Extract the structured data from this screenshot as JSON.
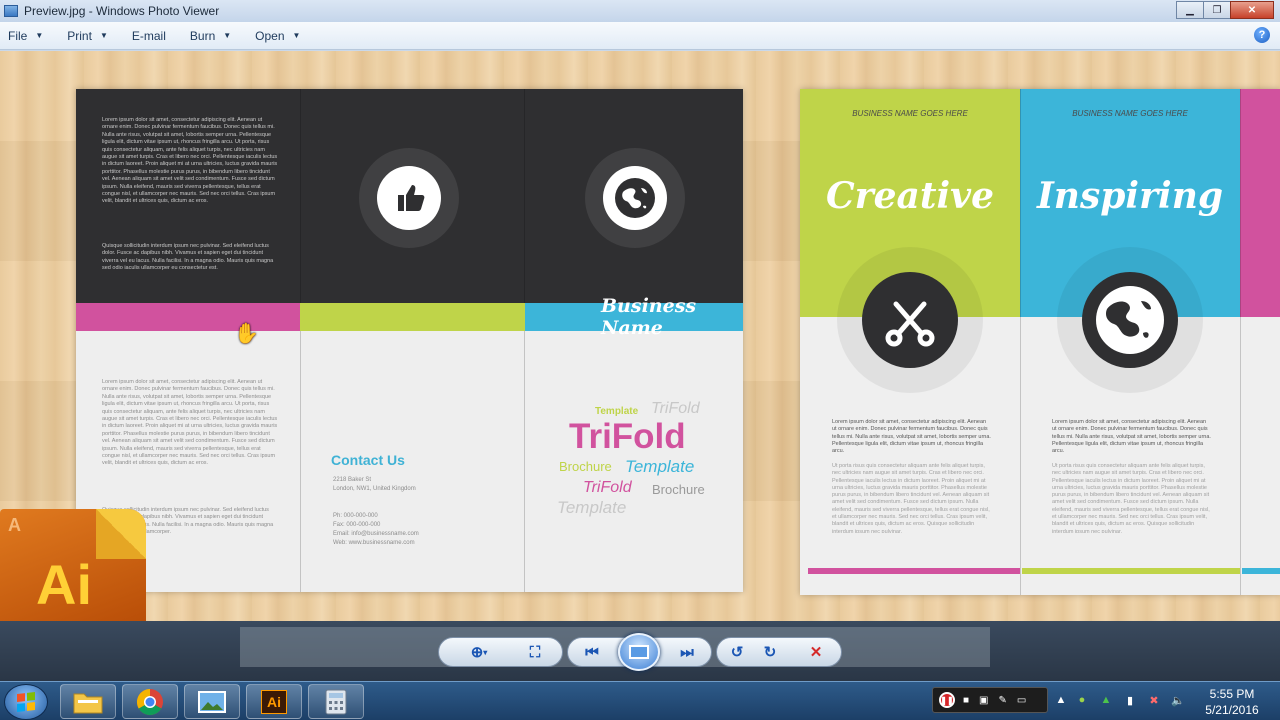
{
  "window": {
    "title": "Preview.jpg - Windows Photo Viewer"
  },
  "menu": {
    "file": "File",
    "print": "Print",
    "email": "E-mail",
    "burn": "Burn",
    "open": "Open"
  },
  "left_brochure": {
    "business_name": "Business Name",
    "contact_title": "Contact Us",
    "address": [
      "2218 Baker St",
      "London, NW1, United Kingdom"
    ],
    "contacts": [
      "Ph: 000-000-000",
      "Fax: 000-000-000",
      "Email: info@businessname.com",
      "Web: www.businessname.com"
    ],
    "word_cloud": {
      "template1": "Template",
      "trifold1": "TriFold",
      "trifold_big": "TriFold",
      "brochure1": "Brochure",
      "template2": "Template",
      "trifold2": "TriFold",
      "brochure2": "Brochure",
      "template3": "Template"
    },
    "lorem_top": "Lorem ipsum dolor sit amet, consectetur adipiscing elit. Aenean ut ornare enim. Donec pulvinar fermentum faucibus. Donec quis tellus mi. Nulla ante risus, volutpat sit amet, lobortis semper urna. Pellentesque ligula elit, dictum vitae ipsum ut, rhoncus fringilla arcu. Ut porta, risus quis consectetur aliquam, ante felis aliquet turpis, nec ultricies nam augue sit amet turpis. Cras et libero nec orci. Pellentesque iaculis lectus in dictum laoreet. Proin aliquet mi at urna ultricies, luctus gravida mauris porttitor. Phasellus molestie purus purus, in bibendum libero tincidunt vel. Aenean aliquam sit amet velit sed condimentum. Fusce sed dictum ipsum. Nulla eleifend, mauris sed viverra pellentesque, tellus erat congue nisl, et ullamcorper nec mauris. Sed nec orci tellus. Cras ipsum velit, blandit et ultrices quis, dictum ac eros.",
    "lorem_top_2": "Quisque sollicitudin interdum ipsum nec pulvinar. Sed eleifend luctus dolor. Fusce ac dapibus nibh. Vivamus et sapien eget dui tincidunt viverra vel eu lacus. Nulla facilisi. In a magna odio. Mauris quis magna sed odio iaculis ullamcorper eu consectetur est.",
    "lorem_bottom": "Lorem ipsum dolor sit amet, consectetur adipiscing elit. Aenean ut ornare enim. Donec pulvinar fermentum faucibus. Donec quis tellus mi. Nulla ante risus, volutpat sit amet, lobortis semper urna. Pellentesque ligula elit, dictum vitae ipsum ut, rhoncus fringilla arcu. Ut porta, risus quis consectetur aliquam, ante felis aliquet turpis, nec ultricies nam augue sit amet turpis. Cras et libero nec orci. Pellentesque iaculis lectus in dictum laoreet. Proin aliquet mi at urna ultricies, luctus gravida mauris porttitor. Phasellus molestie purus purus, in bibendum libero tincidunt vel. Aenean aliquam sit amet velit sed condimentum. Fusce sed dictum ipsum. Nulla eleifend, mauris sed viverra pellentesque, tellus erat congue nisl, et ullamcorper nec mauris. Sed nec orci tellus. Cras ipsum velit, blandit et ultrices quis, dictum ac eros.",
    "lorem_bottom_2": "Quisque sollicitudin interdum ipsum nec pulvinar. Sed eleifend luctus dolor. Fusce ac dapibus nibh. Vivamus et sapien eget dui tincidunt viverra vel eu lacus. Nulla facilisi. In a magna odio. Mauris quis magna sed odio iaculis ullamcorper."
  },
  "right_brochure": {
    "biz1": "BUSINESS NAME GOES HERE",
    "biz2": "BUSINESS NAME GOES HERE",
    "creative": "Creative",
    "inspiring": "Inspiring",
    "body_dark": "Lorem ipsum dolor sit amet, consectetur adipiscing elit. Aenean ut ornare enim. Donec pulvinar fermentum faucibus. Donec quis tellus mi. Nulla ante risus, volutpat sit amet, lobortis semper urna. Pellentesque ligula elit, dictum vitae ipsum ut, rhoncus fringilla arcu.",
    "body_light": "Ut porta risus quis consectetur aliquam ante felis aliquet turpis, nec ultricies nam augue sit amet turpis. Cras et libero nec orci. Pellentesque iaculis lectus in dictum laoreet. Proin aliquet mi at urna ultricies, luctus gravida mauris porttitor. Phasellus molestie purus purus, in bibendum libero tincidunt vel. Aenean aliquam sit amet velit sed condimentum. Fusce sed dictum ipsum. Nulla eleifend, mauris sed viverra pellentesque, tellus erat congue nisl, et ullamcorper nec mauris. Sed nec orci tellus. Cras ipsum velit, blandit et ultrices quis, dictum ac eros. Quisque sollicitudin interdum ipsum nec pulvinar."
  },
  "badge": {
    "ai": "Ai",
    "adobe": "A"
  },
  "taskbar": {
    "ai_label": "Ai",
    "time": "5:55 PM",
    "date": "5/21/2016"
  },
  "colors": {
    "pink": "#d1529e",
    "green": "#bfd449",
    "blue": "#3cb5d9",
    "dark": "#2f2f31",
    "wood": "#e8c898"
  },
  "icons": {
    "thumbs": "thumbs-up-icon",
    "globe": "globe-icon",
    "scissors": "scissors-icon"
  }
}
